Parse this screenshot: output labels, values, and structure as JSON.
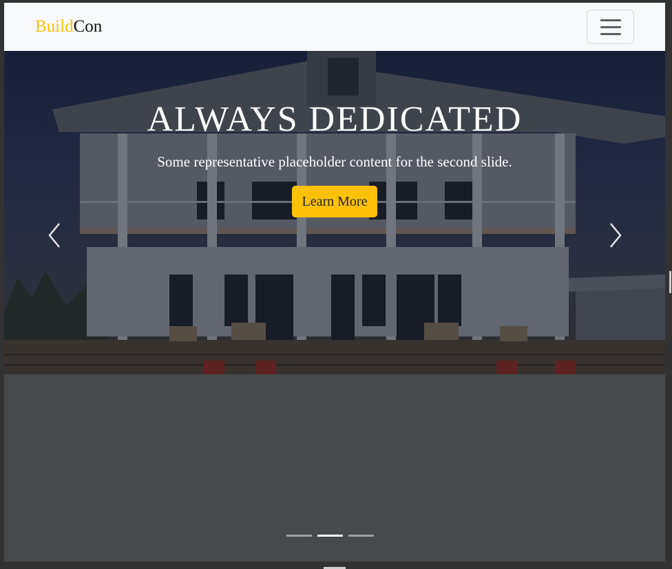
{
  "navbar": {
    "brand_part1": "Build",
    "brand_part2": "Con",
    "toggler_icon": "hamburger-menu-icon"
  },
  "carousel": {
    "active_slide": 2,
    "slide_count": 3,
    "heading": "ALWAYS DEDICATED",
    "text": "Some representative placeholder content for the second slide.",
    "button_label": "Learn More",
    "prev_icon": "chevron-left-icon",
    "next_icon": "chevron-right-icon"
  },
  "colors": {
    "accent": "#ffc107",
    "navbar_bg": "#f8f9fa",
    "carousel_bg": "#464a4c"
  }
}
